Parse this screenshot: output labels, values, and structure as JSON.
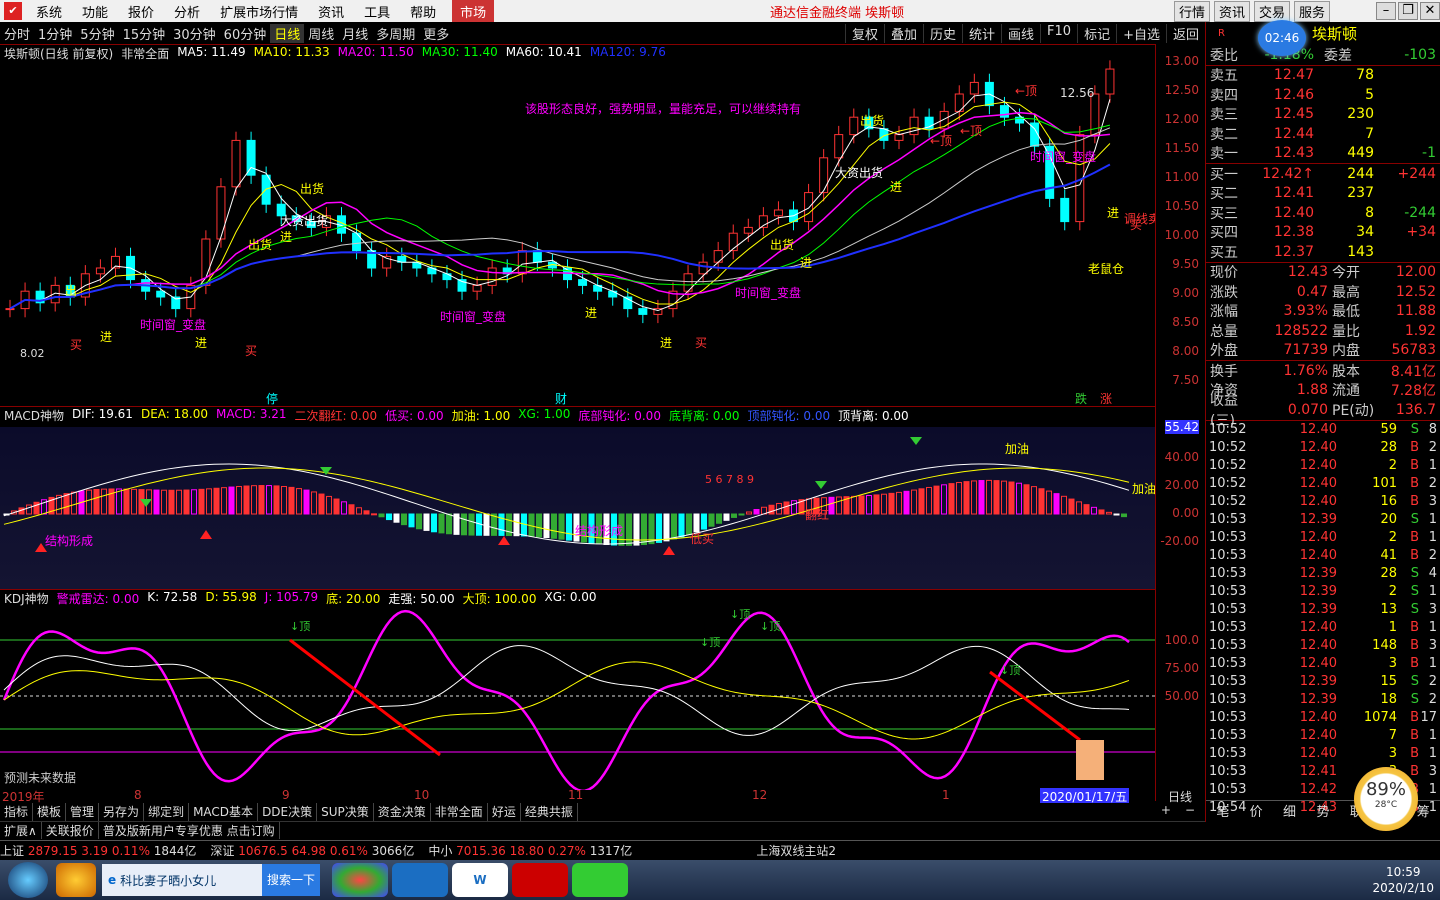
{
  "menu": {
    "items": [
      "系统",
      "功能",
      "报价",
      "分析",
      "扩展市场行情",
      "资讯",
      "工具",
      "帮助"
    ],
    "market": "市场",
    "title": "通达信金融终端  埃斯顿",
    "right_buttons": [
      "行情",
      "资讯",
      "交易",
      "服务"
    ]
  },
  "toolbar": {
    "periods": [
      "分时",
      "1分钟",
      "5分钟",
      "15分钟",
      "30分钟",
      "60分钟",
      "日线",
      "周线",
      "月线",
      "多周期",
      "更多"
    ],
    "active": "日线",
    "right": [
      "复权",
      "叠加",
      "历史",
      "统计",
      "画线",
      "F10",
      "标记",
      "+自选",
      "返回"
    ]
  },
  "main_chart": {
    "title": "埃斯顿(日线 前复权)",
    "mode": "非常全面",
    "ma": [
      {
        "label": "MA5: 11.49",
        "color": "#ffffff"
      },
      {
        "label": "MA10: 11.33",
        "color": "#ffff00"
      },
      {
        "label": "MA20: 11.50",
        "color": "#ff00ff"
      },
      {
        "label": "MA30: 11.40",
        "color": "#00ff00"
      },
      {
        "label": "MA60: 10.41",
        "color": "#ffffff"
      },
      {
        "label": "MA120: 9.76",
        "color": "#2030ff"
      }
    ],
    "yticks": [
      "13.00",
      "12.50",
      "12.00",
      "11.50",
      "11.00",
      "10.50",
      "10.00",
      "9.50",
      "9.00",
      "8.50",
      "8.00",
      "7.50"
    ],
    "comment": "该股形态良好，强势明显，量能充足，可以继续持有",
    "high_label": "12.56",
    "low_label": "8.02",
    "signals": {
      "buy": "买",
      "enter": "进",
      "exit": "出",
      "sell_out": "出货",
      "big_sell": "大资出货",
      "top": "顶",
      "window": "时间窗_变盘",
      "laoshucang": "老鼠仓",
      "tiaozhuan": "调线卖"
    },
    "bottom_markers": [
      "停",
      "财",
      "跌",
      "涨"
    ]
  },
  "macd": {
    "title": "MACD神物",
    "params": [
      {
        "label": "DIF: 19.61",
        "color": "#ffffff"
      },
      {
        "label": "DEA: 18.00",
        "color": "#ffff00"
      },
      {
        "label": "MACD: 3.21",
        "color": "#ff00ff"
      },
      {
        "label": "二次翻红: 0.00",
        "color": "#ff3333"
      },
      {
        "label": "低买: 0.00",
        "color": "#ff00ff"
      },
      {
        "label": "加油: 1.00",
        "color": "#ffff00"
      },
      {
        "label": "XG: 1.00",
        "color": "#00ff00"
      },
      {
        "label": "底部钝化: 0.00",
        "color": "#ff00ff"
      },
      {
        "label": "底背离: 0.00",
        "color": "#00ff00"
      },
      {
        "label": "顶部钝化: 0.00",
        "color": "#3355ff"
      },
      {
        "label": "顶背离: 0.00",
        "color": "#ffffff"
      }
    ],
    "yticks": [
      "55.42",
      "40.00",
      "20.00",
      "0.00",
      "-20.00"
    ],
    "labels": {
      "jiayou": "加油",
      "dimai": "低买",
      "jiegou": "结构形成",
      "fanhong": "翻红",
      "seq": "5 6 7 8 9"
    }
  },
  "kdj": {
    "title": "KDJ神物",
    "params": [
      {
        "label": "警戒雷达: 0.00",
        "color": "#ff00ff"
      },
      {
        "label": "K: 72.58",
        "color": "#ffffff"
      },
      {
        "label": "D: 55.98",
        "color": "#ffff00"
      },
      {
        "label": "J: 105.79",
        "color": "#ff00ff"
      },
      {
        "label": "底: 20.00",
        "color": "#ffff00"
      },
      {
        "label": "走强: 50.00",
        "color": "#ffffff"
      },
      {
        "label": "大顶: 100.00",
        "color": "#ffff00"
      },
      {
        "label": "XG: 0.00",
        "color": "#ffffff"
      }
    ],
    "yticks": [
      "100.0",
      "75.00",
      "50.00"
    ],
    "top_label": "顶",
    "future": "预测未来数据"
  },
  "time_axis": [
    "2019年",
    "8",
    "9",
    "10",
    "11",
    "12",
    "1",
    "2020/01/17/五"
  ],
  "period_label": "日线",
  "bottom_tabs": [
    "指标",
    "模板",
    "管理",
    "另存为",
    "绑定到",
    "MACD基本",
    "DDE决策",
    "SUP决策",
    "资金决策",
    "非常全面",
    "好运",
    "经典共振"
  ],
  "bottom_tabs2": [
    "扩展∧",
    "关联报价",
    "普及版新用户专享优惠 点击订购"
  ],
  "quote": {
    "name": "埃斯顿",
    "clock": "02:46",
    "weibi": {
      "label": "委比",
      "value": "-1.18%",
      "label2": "委差",
      "value2": "-103"
    },
    "asks": [
      {
        "label": "卖五",
        "price": "12.47",
        "vol": "78",
        "chg": ""
      },
      {
        "label": "卖四",
        "price": "12.46",
        "vol": "5",
        "chg": ""
      },
      {
        "label": "卖三",
        "price": "12.45",
        "vol": "230",
        "chg": ""
      },
      {
        "label": "卖二",
        "price": "12.44",
        "vol": "7",
        "chg": ""
      },
      {
        "label": "卖一",
        "price": "12.43",
        "vol": "449",
        "chg": "-1"
      }
    ],
    "bids": [
      {
        "label": "买一",
        "price": "12.42↑",
        "vol": "244",
        "chg": "+244"
      },
      {
        "label": "买二",
        "price": "12.41",
        "vol": "237",
        "chg": ""
      },
      {
        "label": "买三",
        "price": "12.40",
        "vol": "8",
        "chg": "-244"
      },
      {
        "label": "买四",
        "price": "12.38",
        "vol": "34",
        "chg": "+34"
      },
      {
        "label": "买五",
        "price": "12.37",
        "vol": "143",
        "chg": ""
      }
    ],
    "stats": [
      {
        "l1": "现价",
        "v1": "12.43",
        "l2": "今开",
        "v2": "12.00"
      },
      {
        "l1": "涨跌",
        "v1": "0.47",
        "l2": "最高",
        "v2": "12.52"
      },
      {
        "l1": "涨幅",
        "v1": "3.93%",
        "l2": "最低",
        "v2": "11.88"
      },
      {
        "l1": "总量",
        "v1": "128522",
        "l2": "量比",
        "v2": "1.92"
      },
      {
        "l1": "外盘",
        "v1": "71739",
        "l2": "内盘",
        "v2": "56783"
      }
    ],
    "stats2": [
      {
        "l1": "换手",
        "v1": "1.76%",
        "l2": "股本",
        "v2": "8.41亿"
      },
      {
        "l1": "净资",
        "v1": "1.88",
        "l2": "流通",
        "v2": "7.28亿"
      },
      {
        "l1": "收益(三)",
        "v1": "0.070",
        "l2": "PE(动)",
        "v2": "136.7"
      }
    ],
    "ticks": [
      [
        "10:52",
        "12.40",
        "59",
        "S",
        "8"
      ],
      [
        "10:52",
        "12.40",
        "28",
        "B",
        "2"
      ],
      [
        "10:52",
        "12.40",
        "2",
        "B",
        "1"
      ],
      [
        "10:52",
        "12.40",
        "101",
        "B",
        "2"
      ],
      [
        "10:52",
        "12.40",
        "16",
        "B",
        "3"
      ],
      [
        "10:53",
        "12.39",
        "20",
        "S",
        "1"
      ],
      [
        "10:53",
        "12.40",
        "2",
        "B",
        "1"
      ],
      [
        "10:53",
        "12.40",
        "41",
        "B",
        "2"
      ],
      [
        "10:53",
        "12.39",
        "28",
        "S",
        "4"
      ],
      [
        "10:53",
        "12.39",
        "2",
        "S",
        "1"
      ],
      [
        "10:53",
        "12.39",
        "13",
        "S",
        "3"
      ],
      [
        "10:53",
        "12.40",
        "1",
        "B",
        "1"
      ],
      [
        "10:53",
        "12.40",
        "148",
        "B",
        "3"
      ],
      [
        "10:53",
        "12.40",
        "3",
        "B",
        "1"
      ],
      [
        "10:53",
        "12.39",
        "15",
        "S",
        "2"
      ],
      [
        "10:53",
        "12.39",
        "18",
        "S",
        "2"
      ],
      [
        "10:53",
        "12.40",
        "1074",
        "B",
        "17"
      ],
      [
        "10:53",
        "12.40",
        "7",
        "B",
        "1"
      ],
      [
        "10:53",
        "12.40",
        "3",
        "B",
        "1"
      ],
      [
        "10:53",
        "12.41",
        "3",
        "B",
        "3"
      ],
      [
        "10:53",
        "12.42",
        "2",
        "B",
        "1"
      ],
      [
        "10:54",
        "12.43",
        "0",
        "B",
        "1"
      ]
    ],
    "tabs": [
      "笔",
      "价",
      "细",
      "势",
      "联",
      "值",
      "筹"
    ],
    "gauge": "89%",
    "temp": "28°C"
  },
  "status": {
    "items": [
      {
        "name": "上证",
        "val": "2879.15",
        "chg": "3.19",
        "pct": "0.11%",
        "amt": "1844亿"
      },
      {
        "name": "深证",
        "val": "10676.5",
        "chg": "64.98",
        "pct": "0.61%",
        "amt": "3066亿"
      },
      {
        "name": "中小",
        "val": "7015.36",
        "chg": "18.80",
        "pct": "0.27%",
        "amt": "1317亿"
      }
    ],
    "server": "上海双线主站2"
  },
  "taskbar": {
    "app": "科比妻子晒小女儿",
    "search": "搜索一下",
    "time": "10:59",
    "date": "2020/2/10"
  }
}
